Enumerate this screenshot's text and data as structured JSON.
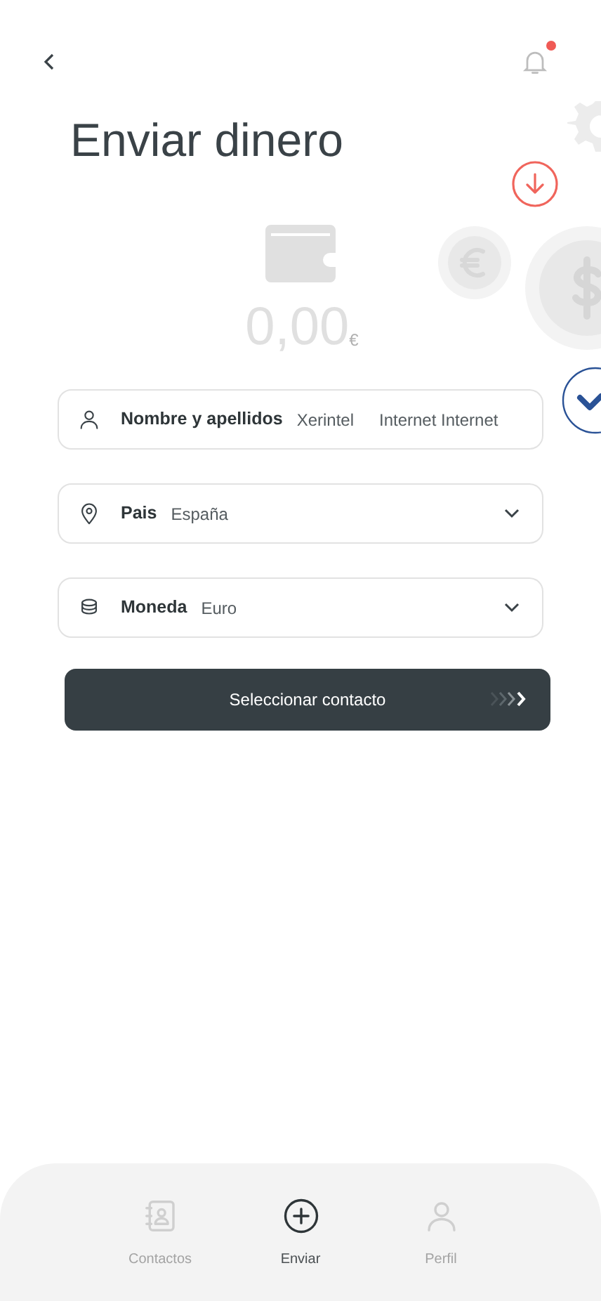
{
  "header": {
    "has_notification": true
  },
  "title": "Enviar dinero",
  "balance": {
    "amount": "0,00",
    "currency": "€"
  },
  "fields": [
    {
      "kind": "text",
      "label": "Nombre y apellidos",
      "values": [
        "Xerintel",
        "Internet Internet"
      ]
    },
    {
      "kind": "select",
      "label": "Pais",
      "values": [
        "España"
      ]
    },
    {
      "kind": "select",
      "label": "Moneda",
      "values": [
        "Euro"
      ]
    }
  ],
  "action_button": {
    "label": "Seleccionar contacto"
  },
  "bottom_nav": [
    {
      "label": "Contactos",
      "selected": false
    },
    {
      "label": "Enviar",
      "selected": true
    },
    {
      "label": "Perfil",
      "selected": false
    }
  ]
}
